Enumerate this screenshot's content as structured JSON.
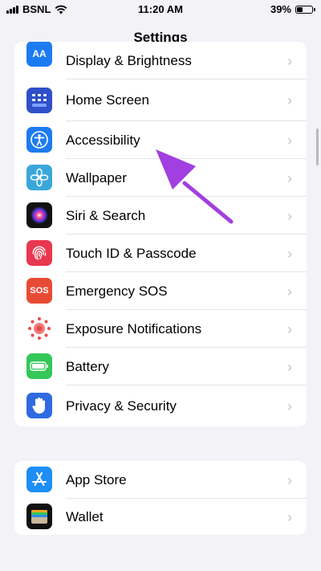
{
  "status": {
    "carrier": "BSNL",
    "time": "11:20 AM",
    "battery": "39%",
    "battery_level": 0.39
  },
  "nav": {
    "title": "Settings"
  },
  "group1": {
    "items": [
      {
        "label": "Display & Brightness",
        "icon": "display-brightness-icon",
        "color": "#1d7bf0"
      },
      {
        "label": "Home Screen",
        "icon": "home-screen-icon",
        "color": "#2f50c8"
      },
      {
        "label": "Accessibility",
        "icon": "accessibility-icon",
        "color": "#1d7bf0"
      },
      {
        "label": "Wallpaper",
        "icon": "wallpaper-icon",
        "color": "#3aa7da"
      },
      {
        "label": "Siri & Search",
        "icon": "siri-icon",
        "color": "#111111"
      },
      {
        "label": "Touch ID & Passcode",
        "icon": "touch-id-icon",
        "color": "#e8384f"
      },
      {
        "label": "Emergency SOS",
        "icon": "emergency-sos-icon",
        "color": "#e84b35",
        "badge": "SOS"
      },
      {
        "label": "Exposure Notifications",
        "icon": "exposure-notifications-icon",
        "color": "#ffffff"
      },
      {
        "label": "Battery",
        "icon": "battery-icon",
        "color": "#34c759"
      },
      {
        "label": "Privacy & Security",
        "icon": "privacy-hand-icon",
        "color": "#2f6ae0"
      }
    ]
  },
  "group2": {
    "items": [
      {
        "label": "App Store",
        "icon": "app-store-icon",
        "color": "#1d8ef5"
      },
      {
        "label": "Wallet",
        "icon": "wallet-icon",
        "color": "#111111"
      }
    ]
  },
  "colors": {
    "background": "#f2f2f7",
    "annotation_arrow": "#a23fe0",
    "chevron": "#c4c4c7"
  }
}
